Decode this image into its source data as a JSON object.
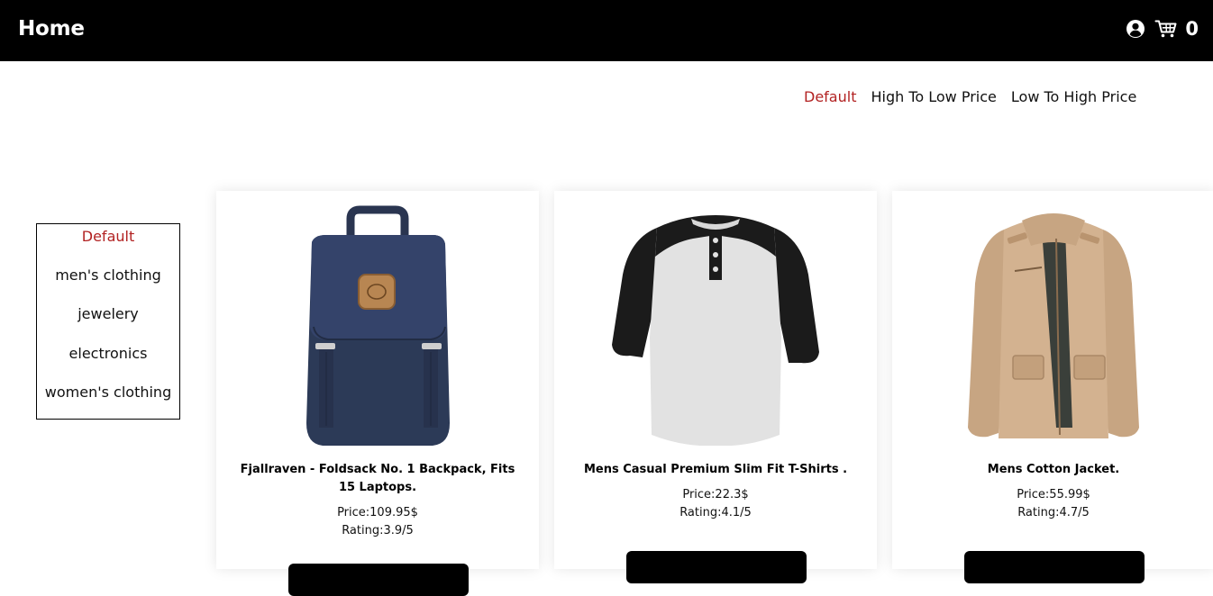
{
  "navbar": {
    "brand": "Home",
    "cart_count": "0",
    "icons": [
      "user-circle-icon",
      "cart-icon"
    ]
  },
  "sort": {
    "options": [
      "Default",
      "High To Low Price",
      "Low To High Price"
    ],
    "active": "Default",
    "active_color": "#b22222"
  },
  "categories": {
    "items": [
      "Default",
      "men's clothing",
      "jewelery",
      "electronics",
      "women's clothing"
    ],
    "active": "Default"
  },
  "products": [
    {
      "title": "Fjallraven - Foldsack No. 1 Backpack, Fits 15 Laptops.",
      "price": "Price:109.95$",
      "rating": "Rating:3.9/5",
      "image": "navy-backpack"
    },
    {
      "title": "Mens Casual Premium Slim Fit T-Shirts .",
      "price": "Price:22.3$",
      "rating": "Rating:4.1/5",
      "image": "raglan-tshirt"
    },
    {
      "title": "Mens Cotton Jacket.",
      "price": "Price:55.99$",
      "rating": "Rating:4.7/5",
      "image": "khaki-jacket"
    }
  ]
}
